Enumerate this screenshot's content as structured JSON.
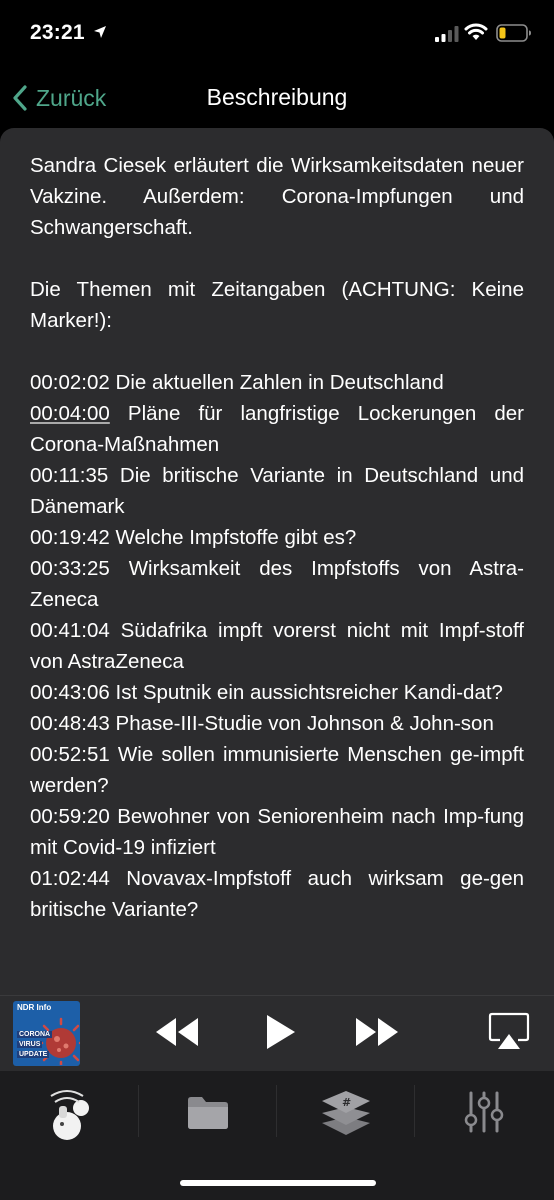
{
  "status_bar": {
    "time": "23:21"
  },
  "nav": {
    "back_label": "Zurück",
    "title": "Beschreibung"
  },
  "description": {
    "intro": "Sandra Ciesek erläutert die Wirksamkeitsdaten neuer Vakzine. Außerdem: Corona-Impfungen und Schwangerschaft.",
    "topics_header": "Die Themen mit Zeitangaben (ACHTUNG: Keine Marker!):",
    "topics": [
      {
        "time": "00:02:02",
        "text": "Die aktuellen Zahlen in Deutschland"
      },
      {
        "time": "00:04:00",
        "text": "Pläne für langfristige Lockerungen der Corona-Maßnahmen"
      },
      {
        "time": "00:11:35",
        "text": "Die britische Variante in Deutschland und Dänemark"
      },
      {
        "time": "00:19:42",
        "text": "Welche Impfstoffe gibt es?"
      },
      {
        "time": "00:33:25",
        "text": "Wirksamkeit des Impfstoffs von Astra-Zeneca"
      },
      {
        "time": "00:41:04",
        "text": "Südafrika impft vorerst nicht mit Impf-stoff von AstraZeneca"
      },
      {
        "time": "00:43:06",
        "text": "Ist Sputnik ein aussichtsreicher Kandi-dat?"
      },
      {
        "time": "00:48:43",
        "text": "Phase-III-Studie von Johnson & John-son"
      },
      {
        "time": "00:52:51",
        "text": "Wie sollen immunisierte Menschen ge-impft werden?"
      },
      {
        "time": "00:59:20",
        "text": "Bewohner von Seniorenheim nach Imp-fung mit Covid-19 infiziert"
      },
      {
        "time": "01:02:44",
        "text": "Novavax-Impfstoff auch wirksam ge-gen britische Variante?"
      }
    ]
  },
  "player": {
    "artwork": {
      "brand": "NDR Info",
      "lines": [
        "CORONA",
        "VIRUS",
        "UPDATE"
      ]
    },
    "icons": [
      "rewind-icon",
      "play-icon",
      "fast-forward-icon",
      "airplay-icon"
    ]
  },
  "tab_bar": {
    "tabs": [
      "podcast-icon",
      "folder-icon",
      "layers-icon",
      "sliders-icon"
    ]
  },
  "colors": {
    "accent": "#4fa68a",
    "card_bg": "#2c2c2e",
    "tab_bg": "#1c1c1e",
    "battery_low": "#f5c518"
  }
}
